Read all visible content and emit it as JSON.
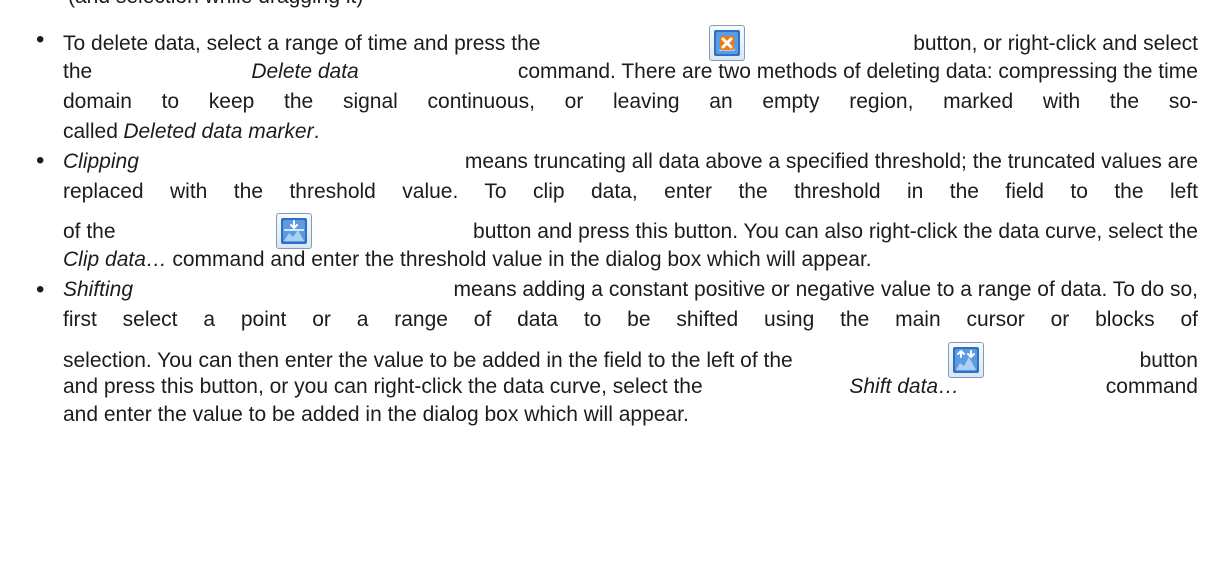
{
  "top_fragment": "(and selection while dragging it)",
  "bullets": [
    {
      "line1": [
        "To delete data, select a range of time and press the",
        "{icon:delete}",
        "button, or right-click and select"
      ],
      "line2": [
        "the",
        "{em:Delete data}",
        "command. There are two methods of deleting data: compressing the time"
      ],
      "line3": [
        "domain to keep the signal continuous, or leaving an empty region, marked with the so-"
      ],
      "line4": [
        "called",
        "{em:Deleted data marker}",
        "."
      ]
    }
  ],
  "text": {
    "b1_l1_a": "To delete data, select a range of time and press the",
    "b1_l1_b": "button, or right-click and select",
    "b1_l2_a": "the",
    "b1_l2_em": "Delete data",
    "b1_l2_b": "command. There are two methods of deleting data: compressing the time",
    "b1_l3": "domain to keep the signal continuous, or leaving an empty region, marked with the so-",
    "b1_l4_a": "called",
    "b1_l4_em": "Deleted data marker",
    "b1_l4_b": ".",
    "b2_l1_em": "Clipping",
    "b2_l1_b": "means truncating all data above a specified threshold; the truncated values are",
    "b2_l2": "replaced with the threshold value. To clip data, enter the threshold in the field to the left",
    "b2_l3_a": "of the",
    "b2_l3_b": "button and press this button. You can also right-click the data curve, select the",
    "b2_l4_em": "Clip data…",
    "b2_l4_b": "command and enter the threshold value in the dialog box which will appear.",
    "b3_l1_em": "Shifting",
    "b3_l1_b": "means adding a constant positive or negative value to a range of data. To do so,",
    "b3_l2": "first select a point or a range of data to be shifted using the main cursor or blocks of",
    "b3_l3_a": "selection. You can then enter the value to be added in the field to the left of the",
    "b3_l3_b": "button",
    "b3_l4_a": "and press this button, or you can right-click the data curve, select the",
    "b3_l4_em": "Shift data…",
    "b3_l4_b": "command",
    "b3_l5": "and enter the value to be added in the dialog box which will appear.",
    "bullet_glyph": "•"
  },
  "icons": {
    "delete": "delete-data-icon",
    "clip": "clip-data-icon",
    "shift": "shift-data-icon"
  },
  "colors": {
    "text": "#1c1c1c",
    "icon_blue": "#2f6fc4",
    "icon_orange": "#f07a12"
  }
}
